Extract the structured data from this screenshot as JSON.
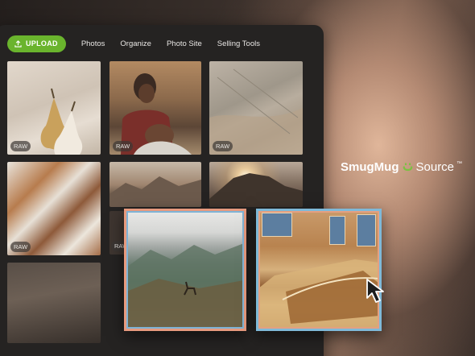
{
  "nav": {
    "upload_label": "UPLOAD",
    "links": [
      "Photos",
      "Organize",
      "Photo Site",
      "Selling Tools"
    ]
  },
  "tiles": {
    "raw_label": "RAW"
  },
  "brand": {
    "name_bold": "SmugMug",
    "name_light": "Source",
    "trademark": "™"
  },
  "colors": {
    "upload_green": "#6ab42d",
    "selection_orange": "#e79a7e",
    "selection_blue": "#7fb9d8"
  },
  "icons": [
    "upload-icon",
    "smugmug-smile-icon",
    "cursor-arrow-icon"
  ]
}
